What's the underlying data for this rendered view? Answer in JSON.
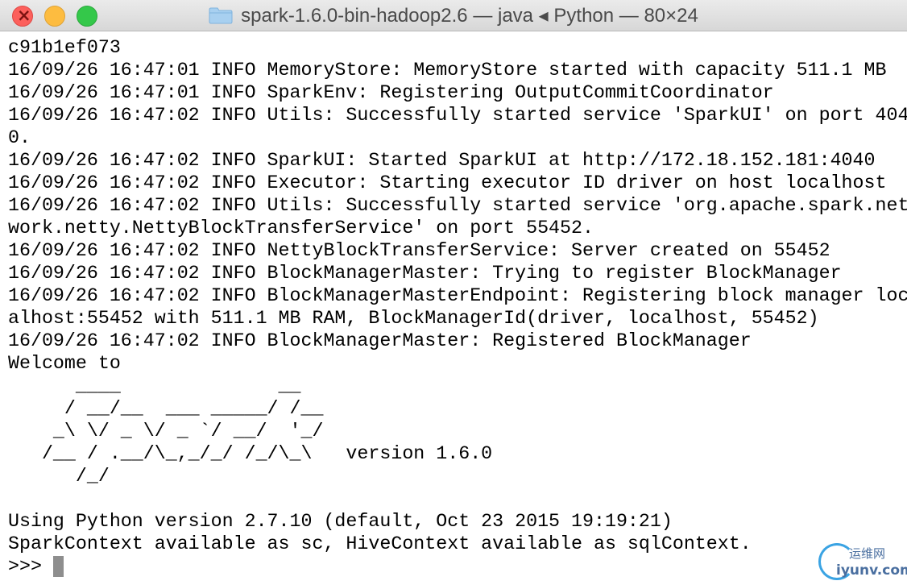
{
  "window": {
    "title": "spark-1.6.0-bin-hadoop2.6 — java ◂ Python — 80×24",
    "controls": [
      "close-icon",
      "minimize-icon",
      "zoom-icon"
    ],
    "folder_icon": "folder-icon"
  },
  "terminal": {
    "lines": [
      "c91b1ef073",
      "16/09/26 16:47:01 INFO MemoryStore: MemoryStore started with capacity 511.1 MB",
      "16/09/26 16:47:01 INFO SparkEnv: Registering OutputCommitCoordinator",
      "16/09/26 16:47:02 INFO Utils: Successfully started service 'SparkUI' on port 404",
      "0.",
      "16/09/26 16:47:02 INFO SparkUI: Started SparkUI at http://172.18.152.181:4040",
      "16/09/26 16:47:02 INFO Executor: Starting executor ID driver on host localhost",
      "16/09/26 16:47:02 INFO Utils: Successfully started service 'org.apache.spark.net",
      "work.netty.NettyBlockTransferService' on port 55452.",
      "16/09/26 16:47:02 INFO NettyBlockTransferService: Server created on 55452",
      "16/09/26 16:47:02 INFO BlockManagerMaster: Trying to register BlockManager",
      "16/09/26 16:47:02 INFO BlockManagerMasterEndpoint: Registering block manager loc",
      "alhost:55452 with 511.1 MB RAM, BlockManagerId(driver, localhost, 55452)",
      "16/09/26 16:47:02 INFO BlockManagerMaster: Registered BlockManager",
      "Welcome to"
    ],
    "banner": [
      "      ____              __",
      "     / __/__  ___ _____/ /__",
      "    _\\ \\/ _ \\/ _ `/ __/  '_/",
      "   /__ / .__/\\_,_/_/ /_/\\_\\   version 1.6.0",
      "      /_/"
    ],
    "blank": "",
    "footer": [
      "Using Python version 2.7.10 (default, Oct 23 2015 19:19:21)",
      "SparkContext available as sc, HiveContext available as sqlContext."
    ],
    "prompt": ">>>"
  },
  "watermark": {
    "cn": "运维网",
    "en": "iyunv.com"
  },
  "colors": {
    "close": "#fc605c",
    "minimize": "#fdbc40",
    "zoom": "#34c84a",
    "cursor": "#8e8e8e"
  }
}
